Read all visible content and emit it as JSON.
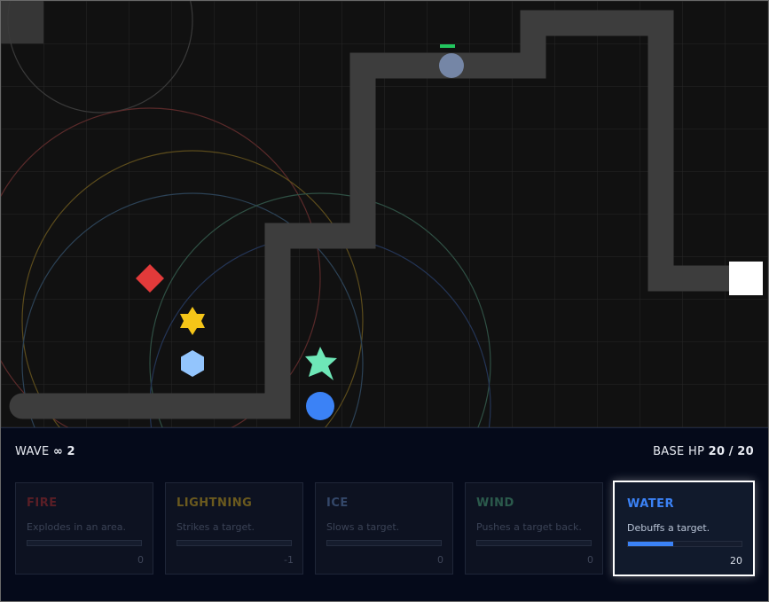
{
  "hud": {
    "wave_label": "WAVE",
    "wave_symbol": "∞",
    "wave_number": "2",
    "base_hp_label": "BASE HP",
    "base_hp_current": "20",
    "base_hp_separator": "/",
    "base_hp_max": "20"
  },
  "colors": {
    "board_background": "#111111",
    "grid_line": "#262626",
    "path": "#3d3d3d",
    "enemy": "#7586a6",
    "health_bar": "#22c55e",
    "fire": "#e23a3a",
    "lightning": "#f5c518",
    "ice": "#93c5fd",
    "wind": "#6ee7b7",
    "water": "#3b82f6"
  },
  "towers": [
    {
      "id": "fire",
      "label": "FIRE",
      "description": "Explodes in an area.",
      "count": "0",
      "progress": 0,
      "selected": false,
      "name_color": "#5a1e26",
      "icon": "diamond-icon"
    },
    {
      "id": "lightning",
      "label": "LIGHTNING",
      "description": "Strikes a target.",
      "count": "-1",
      "progress": 0,
      "selected": false,
      "name_color": "#6b5a1e",
      "icon": "star-icon"
    },
    {
      "id": "ice",
      "label": "ICE",
      "description": "Slows a target.",
      "count": "0",
      "progress": 0,
      "selected": false,
      "name_color": "#34486a",
      "icon": "hexagon-icon"
    },
    {
      "id": "wind",
      "label": "WIND",
      "description": "Pushes a target back.",
      "count": "0",
      "progress": 0,
      "selected": false,
      "name_color": "#2b5a4c",
      "icon": "pinwheel-icon"
    },
    {
      "id": "water",
      "label": "WATER",
      "description": "Debuffs a target.",
      "count": "20",
      "progress": 0.4,
      "selected": true,
      "name_color": "#3b82f6",
      "icon": "circle-icon"
    }
  ],
  "placed_towers": [
    "fire",
    "lightning",
    "ice",
    "wind",
    "water"
  ]
}
